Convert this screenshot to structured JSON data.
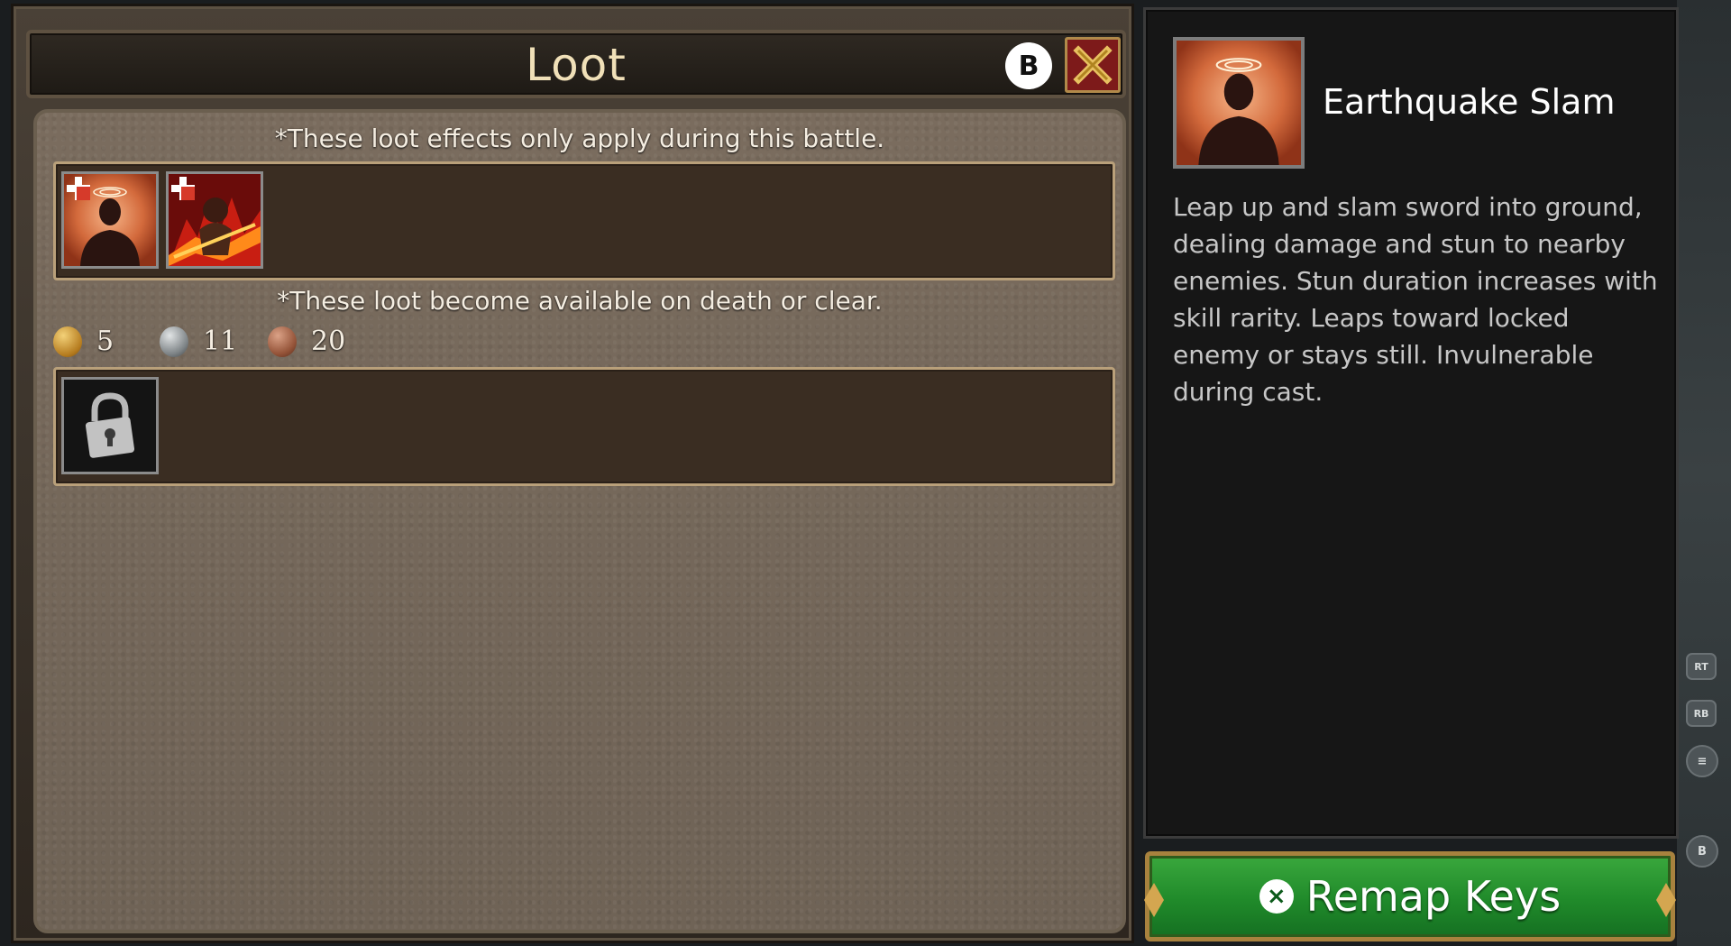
{
  "loot_window": {
    "title": "Loot",
    "close_hint_key": "B",
    "battle_note": "*These loot effects only apply during this battle.",
    "death_note": "*These loot become available on death or clear.",
    "currency": [
      {
        "name": "gold",
        "amount": "5",
        "color": "#c9922a"
      },
      {
        "name": "silver",
        "amount": "11",
        "color": "#8f9496"
      },
      {
        "name": "copper",
        "amount": "20",
        "color": "#9a5a3c"
      }
    ],
    "battle_items": [
      {
        "icon": "earthquake-slam-skill-icon"
      },
      {
        "icon": "fire-demon-skill-icon"
      }
    ],
    "death_items": [
      {
        "icon": "locked-slot-icon"
      }
    ]
  },
  "detail_panel": {
    "skill_name": "Earthquake Slam",
    "description": "Leap up and slam sword into ground, dealing damage and stun to nearby enemies. Stun duration increases with skill rarity. Leaps toward locked enemy or stays still. Invulnerable during cast."
  },
  "remap": {
    "button_key": "×",
    "label": "Remap Keys"
  },
  "controller_hints": [
    "RT",
    "RB",
    "≡",
    "B"
  ],
  "colors": {
    "accent_gold": "#b9a07a",
    "button_green": "#208a2a",
    "close_red": "#7d1a1a"
  }
}
